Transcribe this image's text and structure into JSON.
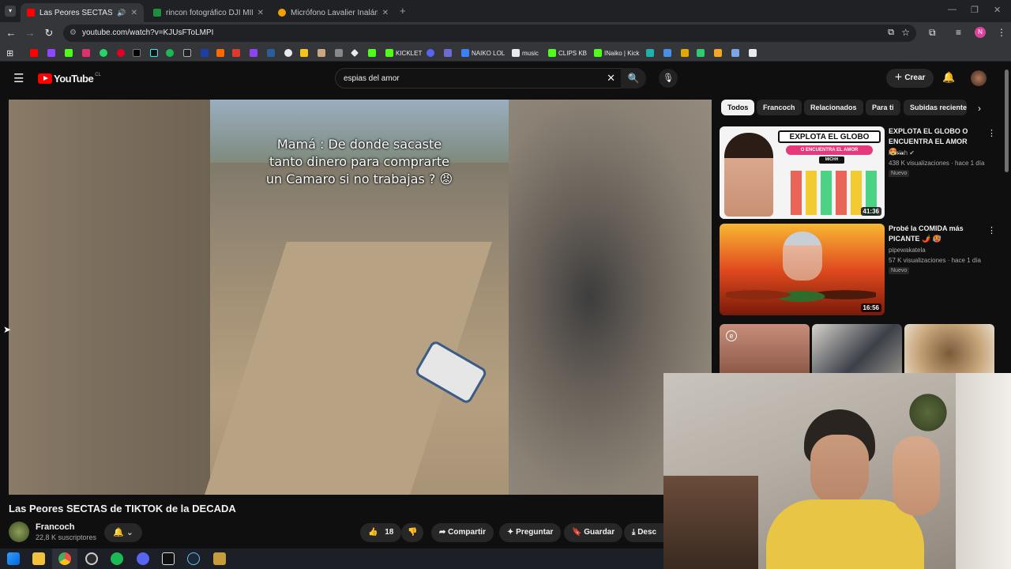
{
  "browser": {
    "tabs": [
      {
        "title": "Las Peores SECTAS de TIKTO",
        "active": true,
        "favicon_color": "#ff0000"
      },
      {
        "title": "rincon fotográfico DJI MINI - G",
        "active": false,
        "favicon_color": "#1e8e3e"
      },
      {
        "title": "Micrófono Lavalier Inalámbrico",
        "active": false,
        "favicon_color": "#f0a000"
      }
    ],
    "new_tab_label": "+",
    "url": "youtube.com/watch?v=KJUsFToLMPI",
    "profile_initial": "N"
  },
  "bookmarks": [
    {
      "label": "KICKLET",
      "color": "#53fc18"
    },
    {
      "label": "NAIKO LOL",
      "color": "#3b82f6"
    },
    {
      "label": "music",
      "color": "#e8eaed"
    },
    {
      "label": "CLIPS KB",
      "color": "#53fc18"
    },
    {
      "label": "INaiko | Kick",
      "color": "#53fc18"
    }
  ],
  "youtube": {
    "logo_text": "YouTube",
    "region": "CL",
    "search_query": "espias del amor",
    "create_label": "Crear"
  },
  "video": {
    "caption_line1": "Mamá : De donde sacaste",
    "caption_line2": "tanto dinero para comprarte",
    "caption_line3": "un Camaro si no trabajas ? 😡",
    "title": "Las Peores SECTAS de TIKTOK de la DECADA",
    "channel": "Francoch",
    "subscribers": "22,8 K suscriptores",
    "likes": "18",
    "share_label": "Compartir",
    "ask_label": "Preguntar",
    "save_label": "Guardar",
    "download_label": "Desc"
  },
  "chips": [
    "Todos",
    "Francoch",
    "Relacionados",
    "Para ti",
    "Subidas recientes"
  ],
  "recommendations": [
    {
      "title": "EXPLOTA EL GLOBO O ENCUENTRA EL AMOR 😍...",
      "channel": "lebriah",
      "meta": "438 K visualizaciones · hace 1 día",
      "badge": "Nuevo",
      "duration": "41:36",
      "thumb_text": "EXPLOTA EL GLOBO",
      "thumb_sub": "O ENCUENTRA EL AMOR",
      "thumb_tag": "MICHH"
    },
    {
      "title": "Probé la COMIDA más PICANTE 🌶️ 🥵",
      "channel": "pipewakatela",
      "meta": "57 K visualizaciones · hace 1 día",
      "badge": "Nuevo",
      "duration": "16:56"
    }
  ],
  "shorts_tag": "e"
}
